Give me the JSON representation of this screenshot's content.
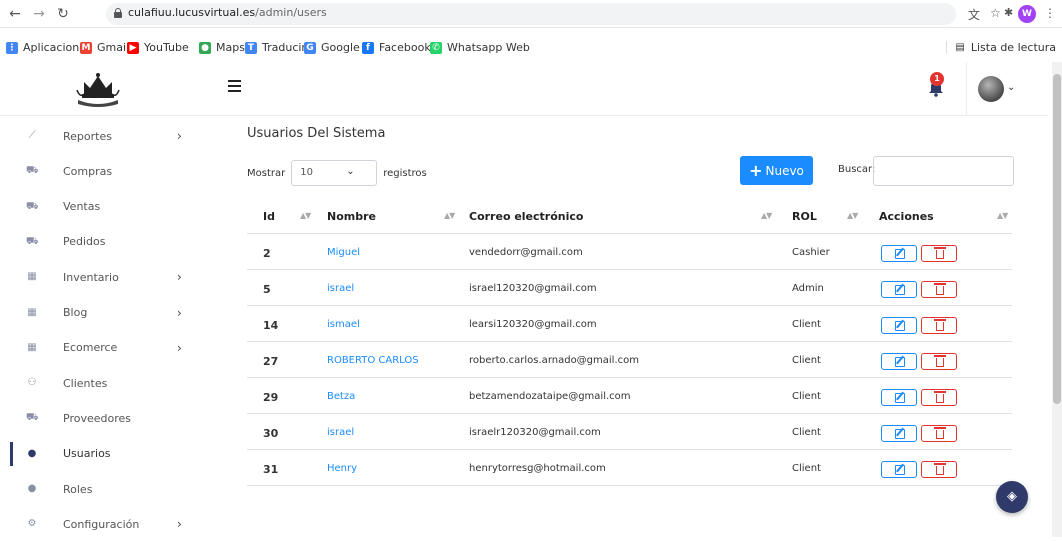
{
  "browser": {
    "url_host": "culafiuu.lucusvirtual.es",
    "url_path": "/admin/users",
    "profile_initial": "W",
    "bookmarks": [
      {
        "label": "Aplicaciones",
        "icon": "apps-grid-icon",
        "color": "#4285f4"
      },
      {
        "label": "Gmail",
        "icon": "gmail-icon",
        "color": "#ea4335"
      },
      {
        "label": "YouTube",
        "icon": "youtube-icon",
        "color": "#ff0000"
      },
      {
        "label": "Maps",
        "icon": "maps-icon",
        "color": "#34a853"
      },
      {
        "label": "Traducir",
        "icon": "translate-icon",
        "color": "#4285f4"
      },
      {
        "label": "Google",
        "icon": "google-icon",
        "color": "#4285f4"
      },
      {
        "label": "Facebook",
        "icon": "facebook-icon",
        "color": "#1877f2"
      },
      {
        "label": "Whatsapp Web",
        "icon": "whatsapp-icon",
        "color": "#25d366"
      }
    ],
    "reading_list": "Lista de lectura"
  },
  "header": {
    "notification_count": "1"
  },
  "sidebar": {
    "items": [
      {
        "label": "Reportes",
        "icon": "chart-icon",
        "submenu": true
      },
      {
        "label": "Compras",
        "icon": "cart-icon",
        "submenu": false
      },
      {
        "label": "Ventas",
        "icon": "cart-icon",
        "submenu": false
      },
      {
        "label": "Pedidos",
        "icon": "truck-icon",
        "submenu": false
      },
      {
        "label": "Inventario",
        "icon": "boxes-icon",
        "submenu": true
      },
      {
        "label": "Blog",
        "icon": "boxes-icon",
        "submenu": true
      },
      {
        "label": "Ecomerce",
        "icon": "boxes-icon",
        "submenu": true
      },
      {
        "label": "Clientes",
        "icon": "users-icon",
        "submenu": false
      },
      {
        "label": "Proveedores",
        "icon": "truck-icon",
        "submenu": false
      },
      {
        "label": "Usuarios",
        "icon": "user-plus-icon",
        "submenu": false,
        "active": true
      },
      {
        "label": "Roles",
        "icon": "user-cog-icon",
        "submenu": false
      },
      {
        "label": "Configuración",
        "icon": "cogs-icon",
        "submenu": true
      }
    ]
  },
  "main": {
    "title": "Usuarios Del Sistema",
    "length_prefix": "Mostrar",
    "length_value": "10",
    "length_suffix": "registros",
    "new_button": "Nuevo",
    "search_label": "Buscar:",
    "search_value": "",
    "columns": [
      "Id",
      "Nombre",
      "Correo electrónico",
      "ROL",
      "Acciones"
    ],
    "rows": [
      {
        "id": "2",
        "name": "Miguel",
        "email": "vendedorr@gmail.com",
        "role": "Cashier"
      },
      {
        "id": "5",
        "name": "israel",
        "email": "israel120320@gmail.com",
        "role": "Admin"
      },
      {
        "id": "14",
        "name": "ismael",
        "email": "learsi120320@gmail.com",
        "role": "Client"
      },
      {
        "id": "27",
        "name": "ROBERTO CARLOS",
        "email": "roberto.carlos.arnado@gmail.com",
        "role": "Client"
      },
      {
        "id": "29",
        "name": "Betza",
        "email": "betzamendozataipe@gmail.com",
        "role": "Client"
      },
      {
        "id": "30",
        "name": "israel",
        "email": "israelr120320@gmail.com",
        "role": "Client"
      },
      {
        "id": "31",
        "name": "Henry",
        "email": "henrytorresg@hotmail.com",
        "role": "Client"
      }
    ]
  },
  "colors": {
    "primary": "#1a8cff",
    "danger": "#e3342f",
    "sidebar_accent": "#2f3a6b"
  }
}
